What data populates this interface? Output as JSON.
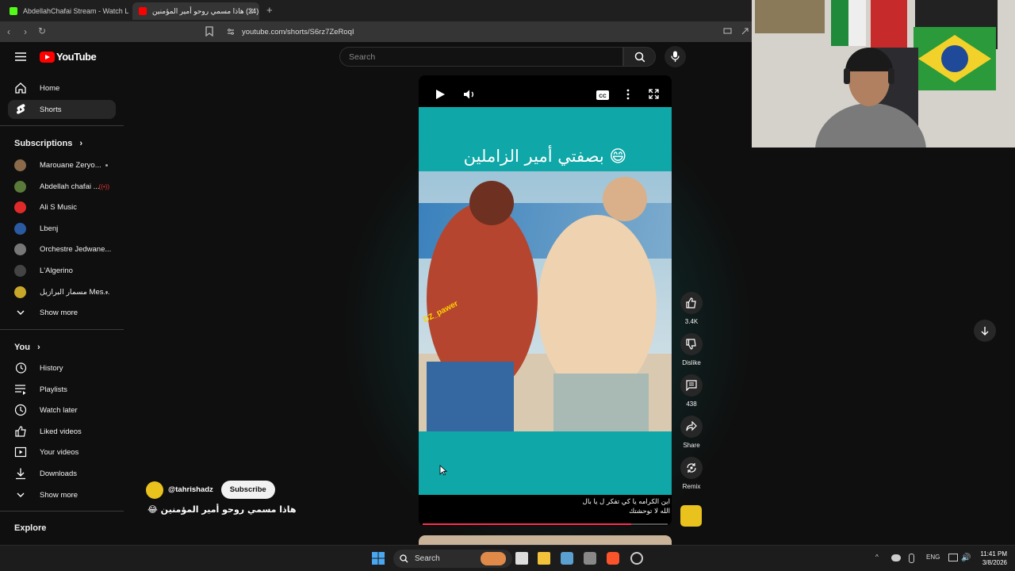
{
  "browser": {
    "tabs": [
      {
        "title": "AbdellahChafai Stream - Watch Live",
        "active": false
      },
      {
        "title": "(24) هاذا مسمي روحو أمير المؤمنين",
        "active": true
      }
    ],
    "url": "youtube.com/shorts/S6rz7ZeRoqI"
  },
  "youtube": {
    "logo_text": "YouTube",
    "search_placeholder": "Search",
    "nav": [
      {
        "label": "Home",
        "icon": "home-icon"
      },
      {
        "label": "Shorts",
        "icon": "shorts-icon",
        "active": true
      }
    ],
    "subscriptions_heading": "Subscriptions",
    "subscriptions": [
      {
        "label": "Marouane Zeryo...",
        "dot": true,
        "color": "#8a6a4a"
      },
      {
        "label": "Abdellah chafai ...",
        "live": true,
        "color": "#5a7a3a"
      },
      {
        "label": "Ali S Music",
        "color": "#e02a2a"
      },
      {
        "label": "Lbenj",
        "color": "#2a5aa0"
      },
      {
        "label": "Orchestre Jedwane...",
        "color": "#777"
      },
      {
        "label": "L'Algerino",
        "color": "#444"
      },
      {
        "label": "مسمار البرازيل Mes...",
        "dot": true,
        "color": "#c8a82a"
      }
    ],
    "show_more": "Show more",
    "you_heading": "You",
    "you_items": [
      {
        "label": "History",
        "icon": "history-icon"
      },
      {
        "label": "Playlists",
        "icon": "playlists-icon"
      },
      {
        "label": "Watch later",
        "icon": "watch-later-icon"
      },
      {
        "label": "Liked videos",
        "icon": "liked-videos-icon"
      },
      {
        "label": "Your videos",
        "icon": "your-videos-icon"
      },
      {
        "label": "Downloads",
        "icon": "downloads-icon"
      }
    ],
    "show_more_2": "Show more",
    "explore_heading": "Explore",
    "short": {
      "overlay_caption": "بصفتي أمير الزاملين 😄",
      "watermark": "DZ_pawer",
      "subtitle_line1": "اين الكرامه يا كي تفكر ل يا بال",
      "subtitle_line2": "الله لا توحشتك",
      "channel": "@tahrishadz",
      "subscribe": "Subscribe",
      "title": "هاذا مسمي روحو أمير المؤمنين 😂",
      "progress": 0.85,
      "accent": "#10a7a8"
    },
    "actions": {
      "likes": "3.4K",
      "dislike": "Dislike",
      "comments": "438",
      "share": "Share",
      "remix": "Remix"
    }
  },
  "taskbar": {
    "search": "Search",
    "lang": "ENG",
    "time": "11:41 PM",
    "date": "3/8/2026"
  }
}
